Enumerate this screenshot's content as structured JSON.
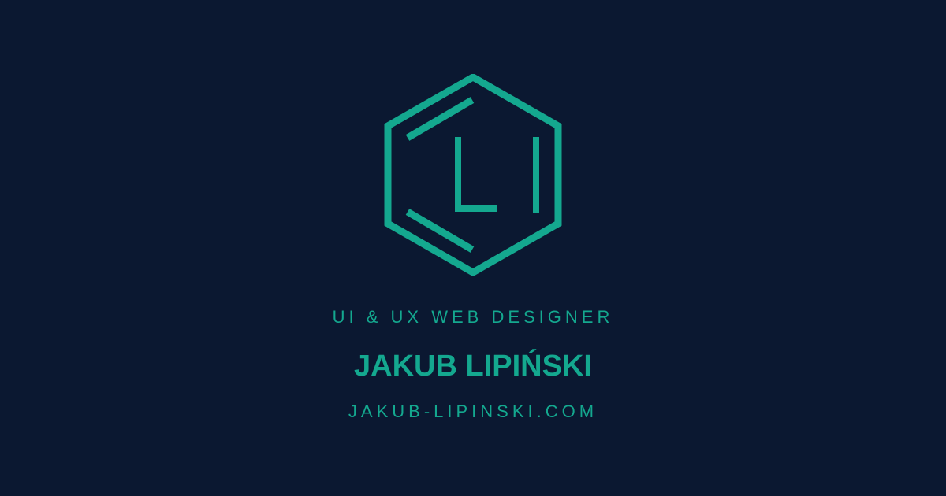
{
  "brand": {
    "logo_letters": "LI",
    "logo_icon": "hexagon-monogram-icon",
    "accent_color": "#14a88f",
    "background_color": "#0b1831"
  },
  "card": {
    "tagline": "UI & UX WEB DESIGNER",
    "name": "JAKUB LIPIŃSKI",
    "website": "JAKUB-LIPINSKI.COM"
  }
}
